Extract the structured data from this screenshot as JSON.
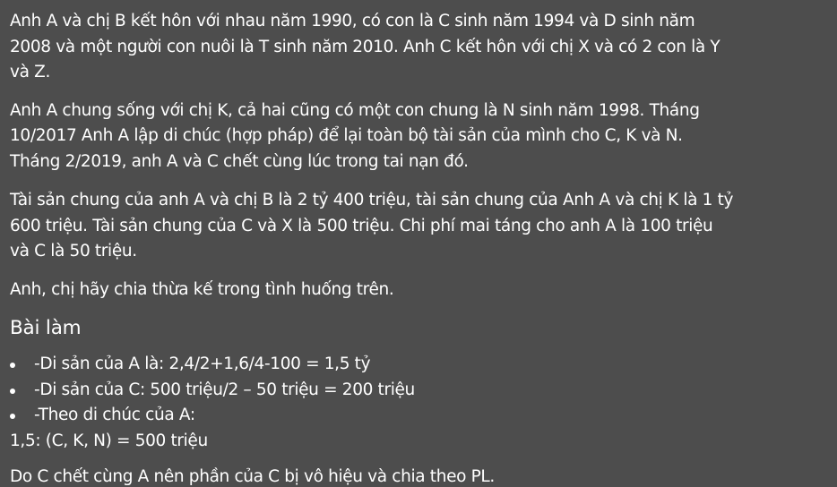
{
  "paragraphs": [
    {
      "lines": [
        "Anh A và chị B kết hôn với nhau năm 1990, có con là C sinh năm 1994 và D sinh năm",
        "2008 và một người con nuôi là T sinh năm 2010. Anh C kết hôn với chị X và có 2 con là Y",
        "và Z."
      ]
    },
    {
      "lines": [
        "Anh A chung sống với chị K, cả hai cũng có một con chung là N sinh năm 1998. Tháng",
        "10/2017 Anh A lập di chúc (hợp pháp) để lại toàn bộ tài sản của mình cho C, K và N.",
        "Tháng 2/2019, anh A và C chết cùng lúc trong tai nạn đó."
      ]
    },
    {
      "lines": [
        "Tài sản chung của anh A và chị B là 2 tỷ 400 triệu, tài sản chung của Anh A và chị K là 1 tỷ",
        "600 triệu. Tài sản chung của C và X là 500 triệu. Chi phí mai táng cho anh A là 100 triệu",
        "và C là 50 triệu."
      ]
    },
    {
      "lines": [
        "Anh, chị hãy chia thừa kế trong tình huống trên."
      ]
    }
  ],
  "heading": "Bài làm",
  "bullets": [
    "-Di sản của A là: 2,4/2+1,6/4-100 = 1,5 tỷ",
    "-Di sản của C: 500 triệu/2 – 50 triệu = 200 triệu",
    "-Theo di chúc của A:"
  ],
  "after_bullets_line": "1,5: (C, K, N) = 500 triệu",
  "final_line": "Do C chết cùng A nên phần của C bị vô hiệu và chia theo PL."
}
